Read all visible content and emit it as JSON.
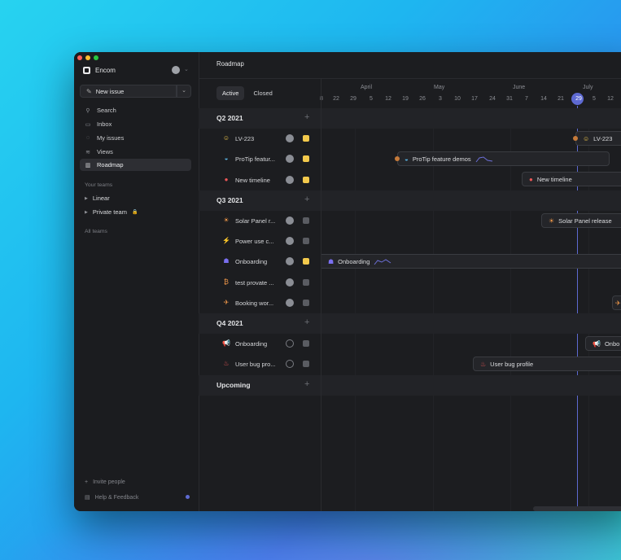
{
  "sidebar": {
    "workspace": "Encom",
    "new_issue": "New issue",
    "nav": [
      {
        "label": "Search",
        "icon": "search-icon"
      },
      {
        "label": "Inbox",
        "icon": "inbox-icon"
      },
      {
        "label": "My issues",
        "icon": "my-issues-icon"
      },
      {
        "label": "Views",
        "icon": "views-icon"
      },
      {
        "label": "Roadmap",
        "icon": "roadmap-icon"
      }
    ],
    "your_teams_label": "Your teams",
    "teams": [
      "Linear",
      "Private team"
    ],
    "all_teams_label": "All teams",
    "invite": "Invite people",
    "help": "Help & Feedback"
  },
  "header": {
    "title": "Roadmap"
  },
  "tabs": [
    "Active",
    "Closed"
  ],
  "timeline": {
    "months": [
      "April",
      "May",
      "June",
      "July"
    ],
    "days": [
      "8",
      "22",
      "29",
      "5",
      "12",
      "19",
      "26",
      "3",
      "10",
      "17",
      "24",
      "31",
      "7",
      "14",
      "21",
      "29",
      "5",
      "12"
    ],
    "today_day": "29"
  },
  "groups": [
    {
      "title": "Q2 2021",
      "projects": [
        {
          "name": "LV-223",
          "icon": "☺",
          "color": "#f2c94c",
          "status": "yellow"
        },
        {
          "name": "ProTip featur...",
          "icon": "◒",
          "color": "#5bb8e8",
          "status": "yellow"
        },
        {
          "name": "New timeline",
          "icon": "●",
          "color": "#eb5757",
          "status": "yellow"
        }
      ]
    },
    {
      "title": "Q3 2021",
      "projects": [
        {
          "name": "Solar Panel r...",
          "icon": "☀",
          "color": "#f2994a",
          "status": "gray"
        },
        {
          "name": "Power use c...",
          "icon": "⚡",
          "color": "#4cb782",
          "status": "gray"
        },
        {
          "name": "Onboarding",
          "icon": "☗",
          "color": "#7a6ff0",
          "status": "yellow"
        },
        {
          "name": "test provate ...",
          "icon": "₿",
          "color": "#f2994a",
          "status": "gray"
        },
        {
          "name": "Booking wor...",
          "icon": "✈",
          "color": "#f2994a",
          "status": "gray"
        }
      ]
    },
    {
      "title": "Q4 2021",
      "projects": [
        {
          "name": "Onboarding",
          "icon": "📢",
          "color": "#4cb782",
          "status": "gray"
        },
        {
          "name": "User bug pro...",
          "icon": "♨",
          "color": "#eb5757",
          "status": "gray"
        }
      ]
    },
    {
      "title": "Upcoming",
      "projects": []
    }
  ],
  "bars": [
    {
      "label": "LV-223",
      "icon": "☺"
    },
    {
      "label": "ProTip feature demos",
      "icon": "◒"
    },
    {
      "label": "New timeline",
      "icon": "●"
    },
    {
      "label": "Solar Panel release",
      "icon": "☀"
    },
    {
      "label": "Onboarding",
      "icon": "☗"
    },
    {
      "label": "Onbo",
      "icon": "📢"
    },
    {
      "label": "User bug profile",
      "icon": "♨"
    }
  ]
}
